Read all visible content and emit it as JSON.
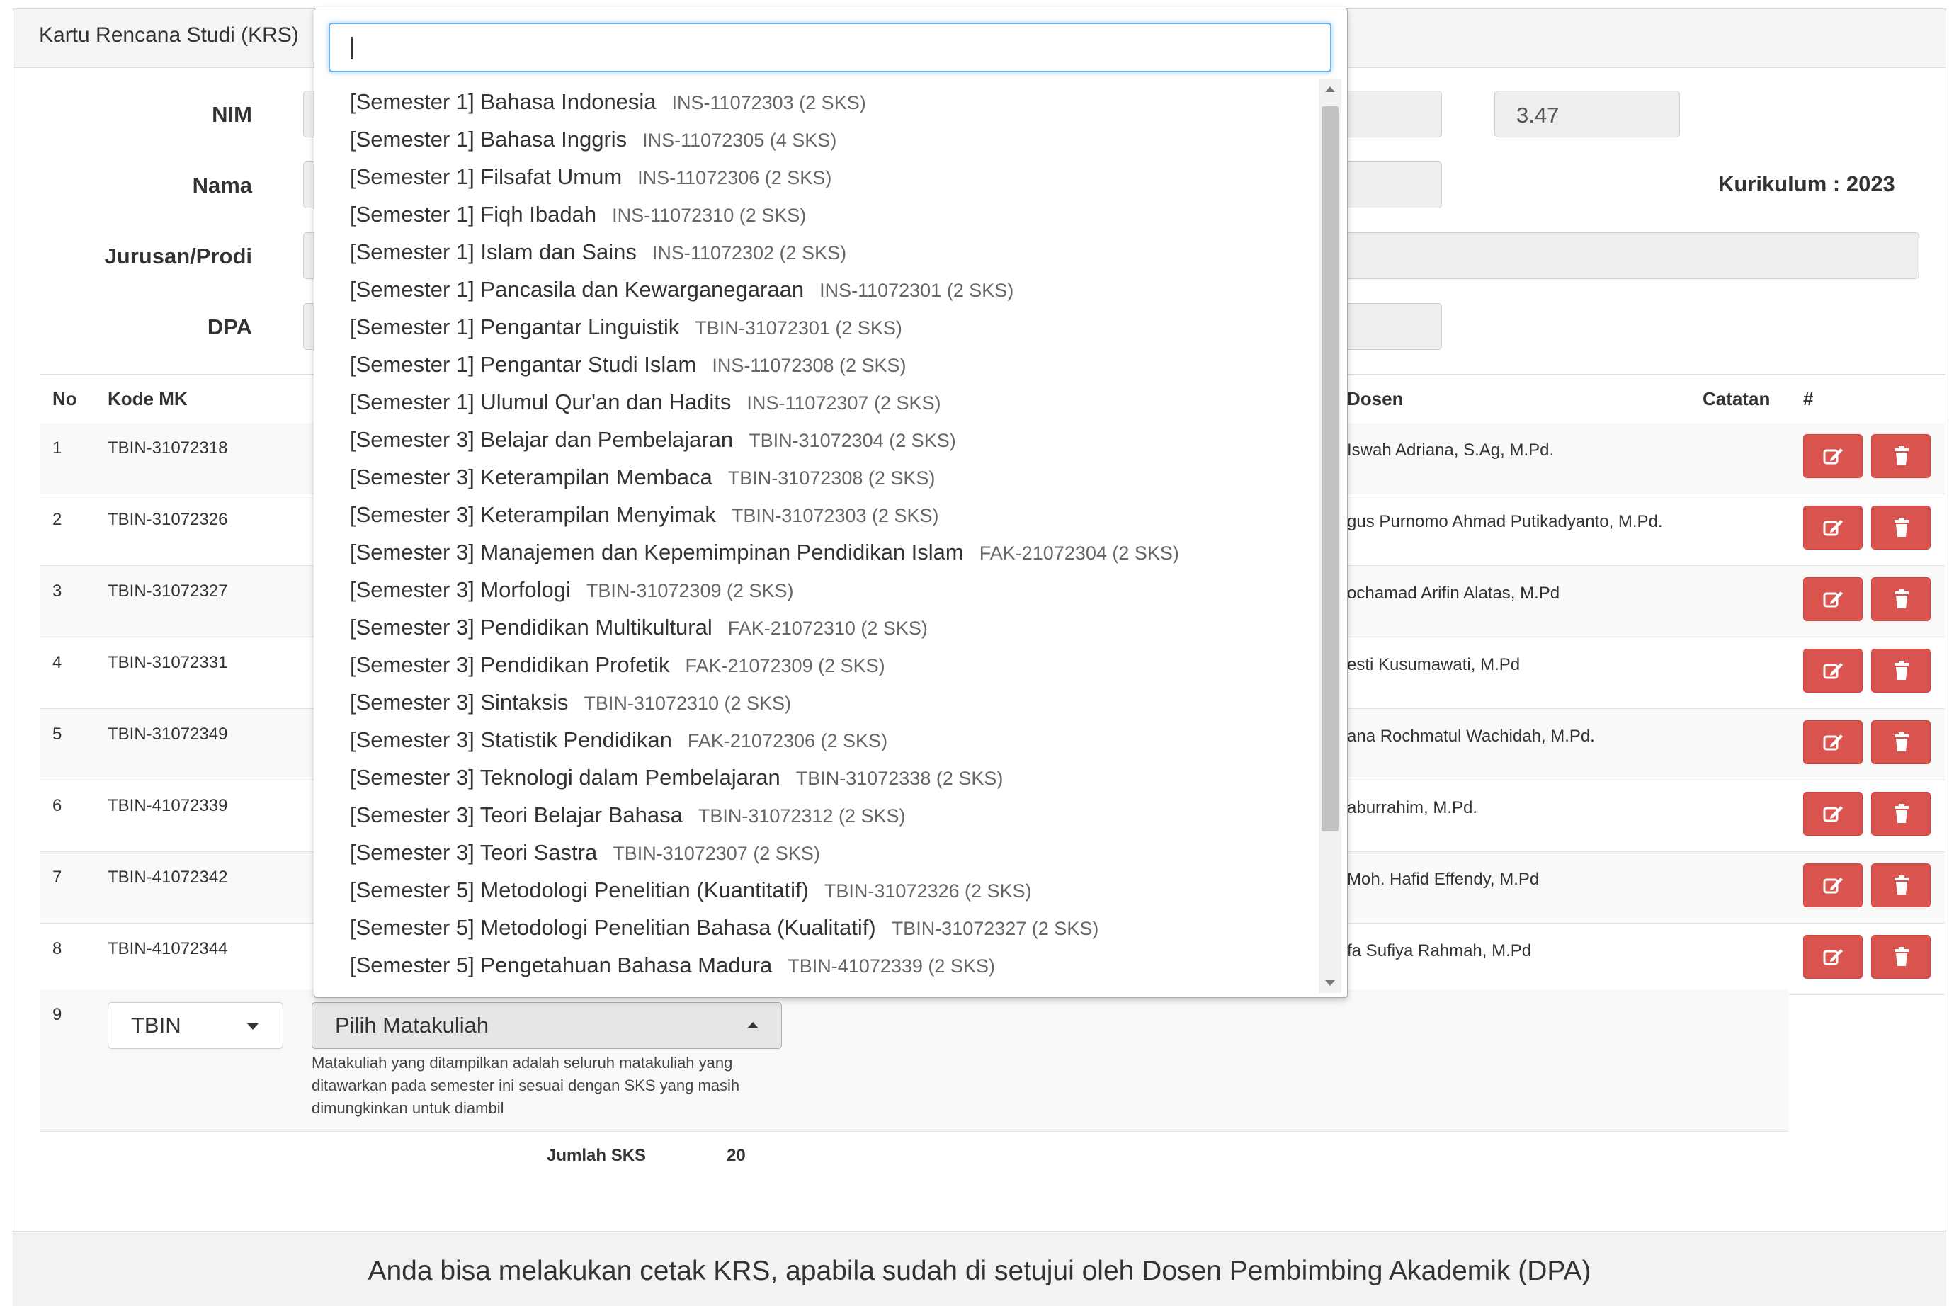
{
  "panel": {
    "title": "Kartu Rencana Studi (KRS)"
  },
  "form": {
    "nim_label": "NIM",
    "nama_label": "Nama",
    "jurusan_label": "Jurusan/Prodi",
    "dpa_label": "DPA",
    "ipk_value": "3.47",
    "kurikulum": "Kurikulum : 2023"
  },
  "table": {
    "headers": {
      "no": "No",
      "kode": "Kode MK",
      "dosen": "Dosen",
      "catatan": "Catatan",
      "action": "#"
    },
    "rows": [
      {
        "no": "1",
        "kode": "TBIN-31072318",
        "dosen": "Iswah Adriana, S.Ag, M.Pd."
      },
      {
        "no": "2",
        "kode": "TBIN-31072326",
        "dosen": "gus Purnomo Ahmad Putikadyanto, M.Pd."
      },
      {
        "no": "3",
        "kode": "TBIN-31072327",
        "dosen": "ochamad Arifin Alatas, M.Pd"
      },
      {
        "no": "4",
        "kode": "TBIN-31072331",
        "dosen": "esti Kusumawati, M.Pd"
      },
      {
        "no": "5",
        "kode": "TBIN-31072349",
        "dosen": "ana Rochmatul Wachidah, M.Pd."
      },
      {
        "no": "6",
        "kode": "TBIN-41072339",
        "dosen": "aburrahim, M.Pd."
      },
      {
        "no": "7",
        "kode": "TBIN-41072342",
        "dosen": "Moh. Hafid Effendy, M.Pd"
      },
      {
        "no": "8",
        "kode": "TBIN-41072344",
        "dosen": "fa Sufiya Rahmah, M.Pd"
      }
    ],
    "new_row": {
      "no": "9",
      "prodi": "TBIN",
      "matakuliah_placeholder": "Pilih Matakuliah",
      "help_text": "Matakuliah yang ditampilkan adalah seluruh matakuliah yang ditawarkan pada semester ini sesuai dengan SKS yang masih dimungkinkan untuk diambil"
    },
    "jumlah_label": "Jumlah SKS",
    "jumlah_value": "20"
  },
  "footer": {
    "text": "Anda bisa melakukan cetak KRS, apabila sudah di setujui oleh Dosen Pembimbing Akademik (DPA)"
  },
  "dropdown": {
    "search_value": "",
    "options": [
      {
        "name": "[Semester 1] Bahasa Indonesia",
        "code": "INS-11072303 (2 SKS)"
      },
      {
        "name": "[Semester 1] Bahasa Inggris",
        "code": "INS-11072305 (4 SKS)"
      },
      {
        "name": "[Semester 1] Filsafat Umum",
        "code": "INS-11072306 (2 SKS)"
      },
      {
        "name": "[Semester 1] Fiqh Ibadah",
        "code": "INS-11072310 (2 SKS)"
      },
      {
        "name": "[Semester 1] Islam dan Sains",
        "code": "INS-11072302 (2 SKS)"
      },
      {
        "name": "[Semester 1] Pancasila dan Kewarganegaraan",
        "code": "INS-11072301 (2 SKS)"
      },
      {
        "name": "[Semester 1] Pengantar Linguistik",
        "code": "TBIN-31072301 (2 SKS)"
      },
      {
        "name": "[Semester 1] Pengantar Studi Islam",
        "code": "INS-11072308 (2 SKS)"
      },
      {
        "name": "[Semester 1] Ulumul Qur'an dan Hadits",
        "code": "INS-11072307 (2 SKS)"
      },
      {
        "name": "[Semester 3] Belajar dan Pembelajaran",
        "code": "TBIN-31072304 (2 SKS)"
      },
      {
        "name": "[Semester 3] Keterampilan Membaca",
        "code": "TBIN-31072308 (2 SKS)"
      },
      {
        "name": "[Semester 3] Keterampilan Menyimak",
        "code": "TBIN-31072303 (2 SKS)"
      },
      {
        "name": "[Semester 3] Manajemen dan Kepemimpinan Pendidikan Islam",
        "code": "FAK-21072304 (2 SKS)"
      },
      {
        "name": "[Semester 3] Morfologi",
        "code": "TBIN-31072309 (2 SKS)"
      },
      {
        "name": "[Semester 3] Pendidikan Multikultural",
        "code": "FAK-21072310 (2 SKS)"
      },
      {
        "name": "[Semester 3] Pendidikan Profetik",
        "code": "FAK-21072309 (2 SKS)"
      },
      {
        "name": "[Semester 3] Sintaksis",
        "code": "TBIN-31072310 (2 SKS)"
      },
      {
        "name": "[Semester 3] Statistik Pendidikan",
        "code": "FAK-21072306 (2 SKS)"
      },
      {
        "name": "[Semester 3] Teknologi dalam Pembelajaran",
        "code": "TBIN-31072338 (2 SKS)"
      },
      {
        "name": "[Semester 3] Teori Belajar Bahasa",
        "code": "TBIN-31072312 (2 SKS)"
      },
      {
        "name": "[Semester 3] Teori Sastra",
        "code": "TBIN-31072307 (2 SKS)"
      },
      {
        "name": "[Semester 5] Metodologi Penelitian (Kuantitatif)",
        "code": "TBIN-31072326 (2 SKS)"
      },
      {
        "name": "[Semester 5] Metodologi Penelitian Bahasa (Kualitatif)",
        "code": "TBIN-31072327 (2 SKS)"
      },
      {
        "name": "[Semester 5] Pengetahuan Bahasa Madura",
        "code": "TBIN-41072339 (2 SKS)"
      }
    ]
  },
  "icons": {
    "edit": "edit-icon",
    "delete": "trash-icon",
    "dropdown_caret": "caret-down-icon",
    "caret_up": "caret-up-icon"
  },
  "colors": {
    "danger": "#d9534f",
    "focus": "#66afe9"
  }
}
